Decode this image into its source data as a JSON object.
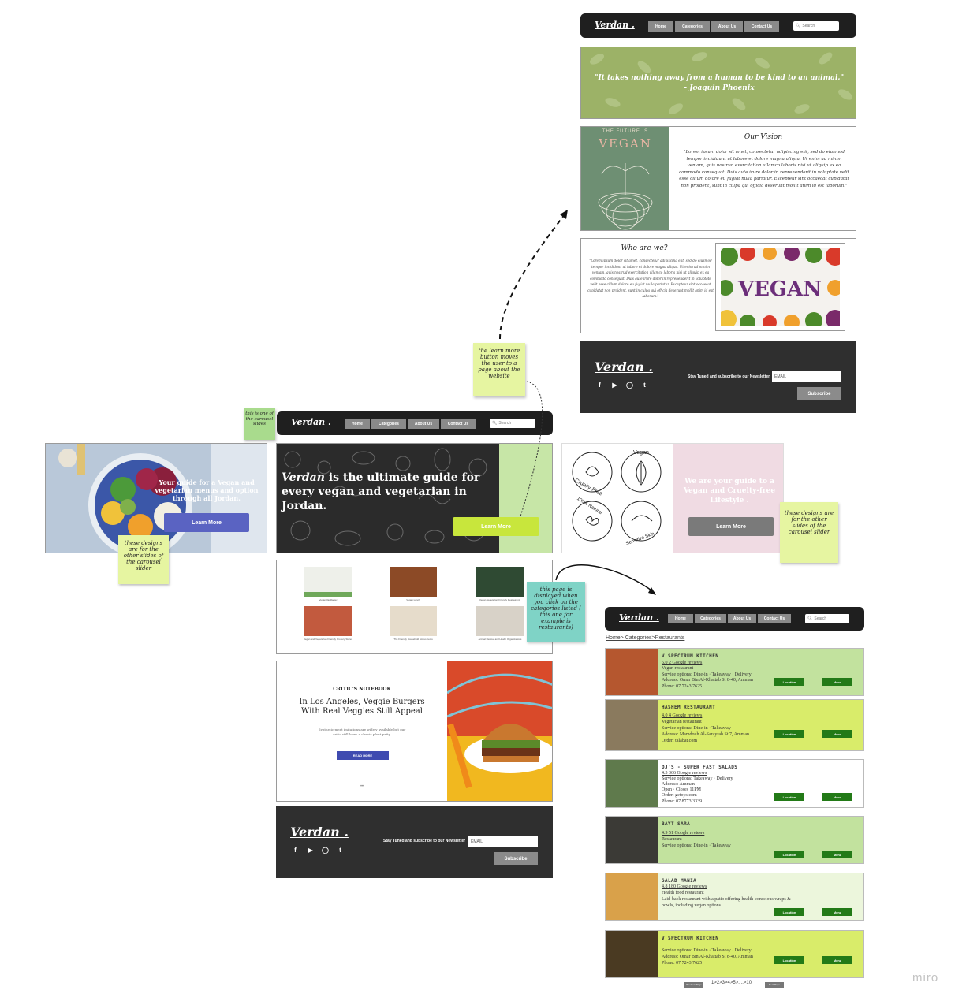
{
  "brand": "Verdan .",
  "nav": {
    "home": "Home",
    "categories": "Categories",
    "about": "About Us",
    "contact": "Contact Us",
    "search_placeholder": "Search"
  },
  "hero": {
    "slide_blue_text": "Your guide for a Vegan and vegetarian menus and option through all Jordan.",
    "main_brand": "Verdan",
    "main_text": " is the ultimate guide for every vegan and vegetarian in Jordan.",
    "slide_pink_text": "We are your guide to a Vegan and Cruelty-free Lifestyle .",
    "learn_more": "Learn More",
    "badges": [
      "Cruelty Free",
      "Vegan",
      "100% Natural",
      "Sensitive Skin"
    ]
  },
  "categories": [
    "Vegan Vanilladay",
    "Vegan Lunch",
    "Vegan Vegetarian Friendly Restaurants",
    "Vegan and Vegetarian Friendly Grocery Stores",
    "The Friendly Household Stores Items",
    "Animal Rescue and Health Organizations"
  ],
  "article": {
    "kicker": "CRITIC'S NOTEBOOK",
    "headline": "In Los Angeles, Veggie Burgers With Real Veggies Still Appeal",
    "blurb": "Synthetic-meat imitations are widely available but our critic still loves a classic plant patty.",
    "read_more": "READ MORE",
    "dots": "•••"
  },
  "footer": {
    "newsletter": "Stay Tuned and subscribe to our Newsletter",
    "email_placeholder": "EMAIL",
    "subscribe": "Subscribe"
  },
  "about_page": {
    "quote_line1": "\"It takes nothing away from a human to be kind to an animal.\"",
    "quote_line2": "- Joaquin Phoenix",
    "poster_top": "THE FUTURE IS",
    "poster_word": "VEGAN",
    "vision_title": "Our Vision",
    "vision_text": "\"Lorem ipsum dolor sit amet, consectetur adipiscing elit, sed do eiusmod tempor incididunt ut labore et dolore magna aliqua. Ut enim ad minim veniam, quis nostrud exercitation ullamco laboris nisi ut aliquip ex ea commodo consequat. Duis aute irure dolor in reprehenderit in voluptate velit esse cillum dolore eu fugiat nulla pariatur. Excepteur sint occaecat cupidatat non proident, sunt in culpa qui officia deserunt mollit anim id est laborum.\"",
    "who_title": "Who are we?",
    "who_text": "\"Lorem ipsum dolor sit amet, consectetur adipiscing elit, sed do eiusmod tempor incididunt ut labore et dolore magna aliqua. Ut enim ad minim veniam, quis nostrud exercitation ullamco laboris nisi ut aliquip ex ea commodo consequat. Duis aute irure dolor in reprehenderit in voluptate velit esse cillum dolore eu fugiat nulla pariatur. Excepteur sint occaecat cupidatat non proident, sunt in culpa qui officia deserunt mollit anim id est laborum.\"",
    "vegan_image_word": "VEGAN"
  },
  "restaurants_page": {
    "breadcrumb": "Home> Categories>Restaurants",
    "location_btn": "Location",
    "menu_btn": "Menu",
    "pager_prev": "Previous Page",
    "pager_pages": "1>2>3>4>5>....>10",
    "pager_next": "Next Page",
    "items": [
      {
        "name": "V SPECTRUM KITCHEN",
        "lines": [
          "5.0 2 Google reviews",
          "Vegan restaurant",
          "Service options: Dine-in · Takeaway · Delivery",
          "Address: Omar Bin Al-Khattab St 8-40, Amman",
          "Phone: 07 7243 7625"
        ],
        "bg": "#c2e29e"
      },
      {
        "name": "HASHEM RESTAURANT",
        "lines": [
          "4.0 4 Google reviews",
          "Vegetarian restaurant",
          "Service options: Dine-in · Takeaway",
          "Address: Mamdouh Al-Sarayrah St 7, Amman",
          "Order: talabat.com"
        ],
        "bg": "#d9ec6a"
      },
      {
        "name": "DJ'S - SUPER FAST SALADS",
        "lines": [
          "4.3 366 Google reviews",
          "Service options: Takeaway · Delivery",
          "Address: Amman",
          "Open · Closes 11PM",
          "Order: getoys.com",
          "Phone: 07 8773 3339"
        ],
        "bg": "#ffffff"
      },
      {
        "name": "BAYT SARA",
        "lines": [
          "4.9 51 Google reviews",
          "Restaurant",
          "Service options: Dine-in · Takeaway"
        ],
        "bg": "#c2e29e"
      },
      {
        "name": "SALAD MANIA",
        "lines": [
          "4.8 180 Google reviews",
          "Health food restaurant",
          "Laid-back restaurant with a patio offering health-conscious wraps &",
          "bowls, including vegan options."
        ],
        "bg": "#ecf6dc"
      },
      {
        "name": "V SPECTRUM KITCHEN",
        "lines": [
          "Service options: Dine-in · Takeaway · Delivery",
          "Address: Omar Bin Al-Khattab St 8-40, Amman",
          "Phone: 07 7243 7625"
        ],
        "bg": "#d9ec6a"
      }
    ]
  },
  "notes": {
    "learn_more_note": "the learn more button moves the user to a page about the website",
    "carousel_note": "this is one of the carousel slides",
    "other_slides_left": "these designs are for the other slides of the carousel slider",
    "other_slides_right": "these designs are for the other slides of the carousel slider",
    "categories_note": "this page is displayed when you click on the categories listed ( this one for example is restaurants)"
  },
  "watermark": "miro",
  "colors": {
    "nav_bg": "#1f1f1f",
    "lime": "#c8e660",
    "accent_blue": "#5a63c2",
    "green_btn": "#237a17",
    "footer_bg": "#2f2f2f",
    "pink": "#f0dbe3"
  }
}
